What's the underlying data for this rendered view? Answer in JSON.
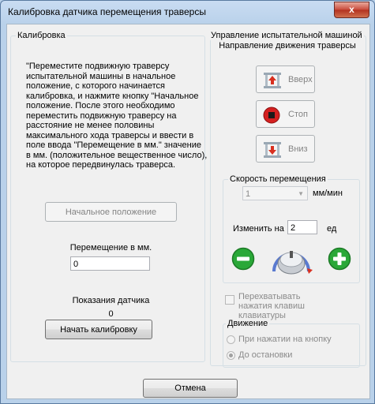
{
  "window": {
    "title": "Калибровка датчика перемещения траверсы",
    "close_glyph": "x"
  },
  "calibration": {
    "group_title": "Калибровка",
    "instructions": "\"Переместите подвижную траверсу испытательной машины в начальное положение, с которого начинается калибровка, и нажмите кнопку \"Начальное положение. После этого необходимо переместить подвижную траверсу на расстояние не менее половины максимального хода траверсы и ввести в поле ввода \"Перемещение в мм.\" значение в мм. (положительное вещественное число), на которое передвинулась траверса.",
    "initial_position_button": "Начальное положение",
    "movement_label": "Перемещение в мм.",
    "movement_value": "0",
    "sensor_label": "Показания датчика",
    "sensor_value": "0",
    "start_button": "Начать калибровку"
  },
  "control": {
    "group_title": "Управление испытательной машиной",
    "direction_title": "Направление движения траверсы",
    "up_button": "Вверх",
    "stop_button": "Стоп",
    "down_button": "Вниз",
    "speed_title": "Скорость перемещения",
    "speed_value": "1",
    "speed_unit": "мм/мин",
    "change_label": "Изменить на",
    "change_value": "2",
    "change_unit": "ед",
    "intercept_keys": "Перехватывать нажатия клавиш клавиатуры",
    "movement_title": "Движение",
    "radio_on_press": "При нажатии на кнопку",
    "radio_until_stop": "До остановки"
  },
  "cancel_button": "Отмена",
  "colors": {
    "stop_red": "#d42020",
    "plus_green": "#2aa838",
    "arrow_red": "#d83020"
  }
}
